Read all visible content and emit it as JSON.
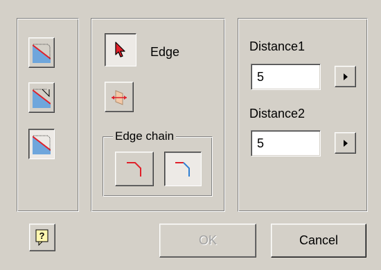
{
  "select_label": "Edge",
  "edge_chain_label": "Edge chain",
  "distance1": {
    "label": "Distance1",
    "value": "5"
  },
  "distance2": {
    "label": "Distance2",
    "value": "5"
  },
  "buttons": {
    "ok": "OK",
    "cancel": "Cancel"
  },
  "icons": {
    "mode1": "chamfer-distance-icon",
    "mode2": "chamfer-distance-angle-icon",
    "mode3": "chamfer-two-distances-icon",
    "select": "select-arrow-icon",
    "flip": "flip-direction-icon",
    "chain_all": "edge-chain-all-icon",
    "chain_single": "edge-chain-single-icon",
    "help": "help-icon"
  },
  "colors": {
    "accent_red": "#e0202a",
    "accent_blue": "#2f7fd2",
    "disabled_text": "#a0a0a0"
  }
}
